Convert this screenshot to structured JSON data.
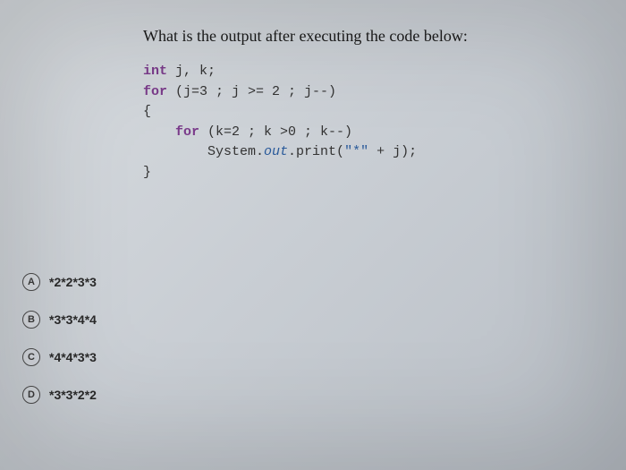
{
  "question": {
    "title": "What is the output after executing the code below:",
    "code": {
      "l1_kw1": "int",
      "l1_rest": " j, k;",
      "l2_kw1": "for",
      "l2_rest": " (j=3 ; j >= 2 ; j--)",
      "l3": "{",
      "l4_kw1": "for",
      "l4_rest": " (k=2 ; k >0 ; k--)",
      "l5_pre": "        System.",
      "l5_field": "out",
      "l5_post": ".print(",
      "l5_str": "\"*\"",
      "l5_end": " + j);",
      "l6": "}"
    }
  },
  "options": [
    {
      "letter": "A",
      "text": "*2*2*3*3"
    },
    {
      "letter": "B",
      "text": "*3*3*4*4"
    },
    {
      "letter": "C",
      "text": "*4*4*3*3"
    },
    {
      "letter": "D",
      "text": "*3*3*2*2"
    }
  ]
}
